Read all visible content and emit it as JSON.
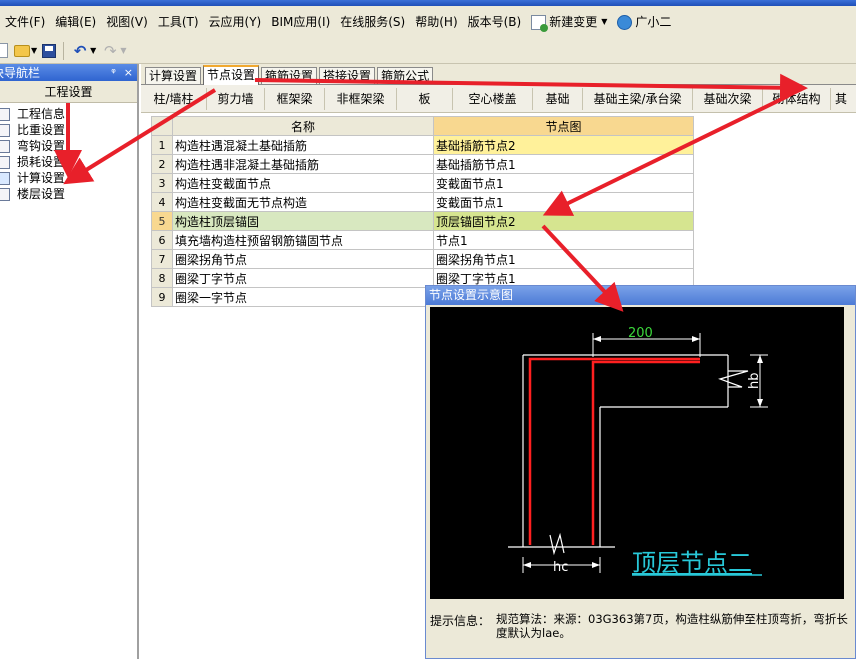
{
  "menubar": {
    "items": [
      "文件(F)",
      "编辑(E)",
      "视图(V)",
      "工具(T)",
      "云应用(Y)",
      "BIM应用(I)",
      "在线服务(S)",
      "帮助(H)",
      "版本号(B)"
    ],
    "new_change": "新建变更",
    "helper": "广小二"
  },
  "nav": {
    "title": "块导航栏",
    "pin_glyph": "ᵠ",
    "close_glyph": "×",
    "section": "工程设置",
    "items": [
      "工程信息",
      "比重设置",
      "弯钩设置",
      "损耗设置",
      "计算设置",
      "楼层设置"
    ]
  },
  "tabs": [
    "计算设置",
    "节点设置",
    "箍筋设置",
    "搭接设置",
    "箍筋公式"
  ],
  "subtabs": [
    "柱/墙柱",
    "剪力墙",
    "框架梁",
    "非框架梁",
    "板",
    "空心楼盖",
    "基础",
    "基础主梁/承台梁",
    "基础次梁",
    "砌体结构",
    "其"
  ],
  "grid": {
    "headers": [
      "名称",
      "节点图"
    ],
    "rows": [
      {
        "num": "1",
        "name": "构造柱遇混凝土基础插筋",
        "node": "基础插筋节点2"
      },
      {
        "num": "2",
        "name": "构造柱遇非混凝土基础插筋",
        "node": "基础插筋节点1"
      },
      {
        "num": "3",
        "name": "构造柱变截面节点",
        "node": "变截面节点1"
      },
      {
        "num": "4",
        "name": "构造柱变截面无节点构造",
        "node": "变截面节点1"
      },
      {
        "num": "5",
        "name": "构造柱顶层锚固",
        "node": "顶层锚固节点2"
      },
      {
        "num": "6",
        "name": "填充墙构造柱预留钢筋锚固节点",
        "node": "节点1"
      },
      {
        "num": "7",
        "name": "圈梁拐角节点",
        "node": "圈梁拐角节点1"
      },
      {
        "num": "8",
        "name": "圈梁丁字节点",
        "node": "圈梁丁字节点1"
      },
      {
        "num": "9",
        "name": "圈梁一字节点",
        "node": ""
      }
    ]
  },
  "dialog": {
    "title": "节点设置示意图",
    "dim_top": "200",
    "dim_right": "hb",
    "dim_bottom": "hc",
    "caption": "顶层节点二",
    "info_label": "提示信息：",
    "info_text": "规范算法：来源：03G363第7页，构造柱纵筋伸至柱顶弯折，弯折长度默认为lae。"
  },
  "colors": {
    "annotation_red": "#e8202a",
    "rebar_red": "#ff2020",
    "dim_green": "#3cd83c",
    "caption_cyan": "#28c8d8",
    "highlight_yellow": "#fff19a",
    "highlight_green": "#d6e590"
  }
}
